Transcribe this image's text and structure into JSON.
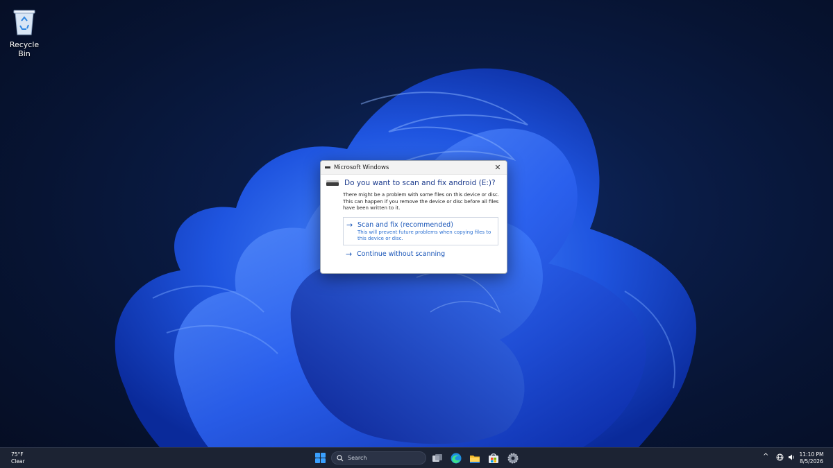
{
  "desktop": {
    "icons": [
      {
        "label": "Recycle Bin",
        "icon": "recycle-bin-icon"
      }
    ]
  },
  "dialog": {
    "title": "Microsoft Windows",
    "close_glyph": "✕",
    "heading": "Do you want to scan and fix android (E:)?",
    "description": "There might be a problem with some files on this device or disc. This can happen if you remove the device or disc before all files have been written to it.",
    "options": [
      {
        "title": "Scan and fix (recommended)",
        "subtitle": "This will prevent future problems when copying files to this device or disc.",
        "icon": "arrow-right-icon"
      },
      {
        "title": "Continue without scanning",
        "subtitle": "",
        "icon": "arrow-right-icon"
      }
    ],
    "arrow_glyph": "→",
    "accent_color": "#1a56b8"
  },
  "taskbar": {
    "weather": {
      "temp": "75°F",
      "condition": "Clear"
    },
    "search_placeholder": "Search",
    "apps": [
      "task-view-icon",
      "edge-icon",
      "file-explorer-icon",
      "store-icon",
      "settings-icon"
    ],
    "tray": {
      "chevron": "^",
      "network": "network-icon",
      "volume": "volume-icon"
    },
    "clock": {
      "time": "11:10 PM",
      "date": "8/5/2026"
    }
  }
}
